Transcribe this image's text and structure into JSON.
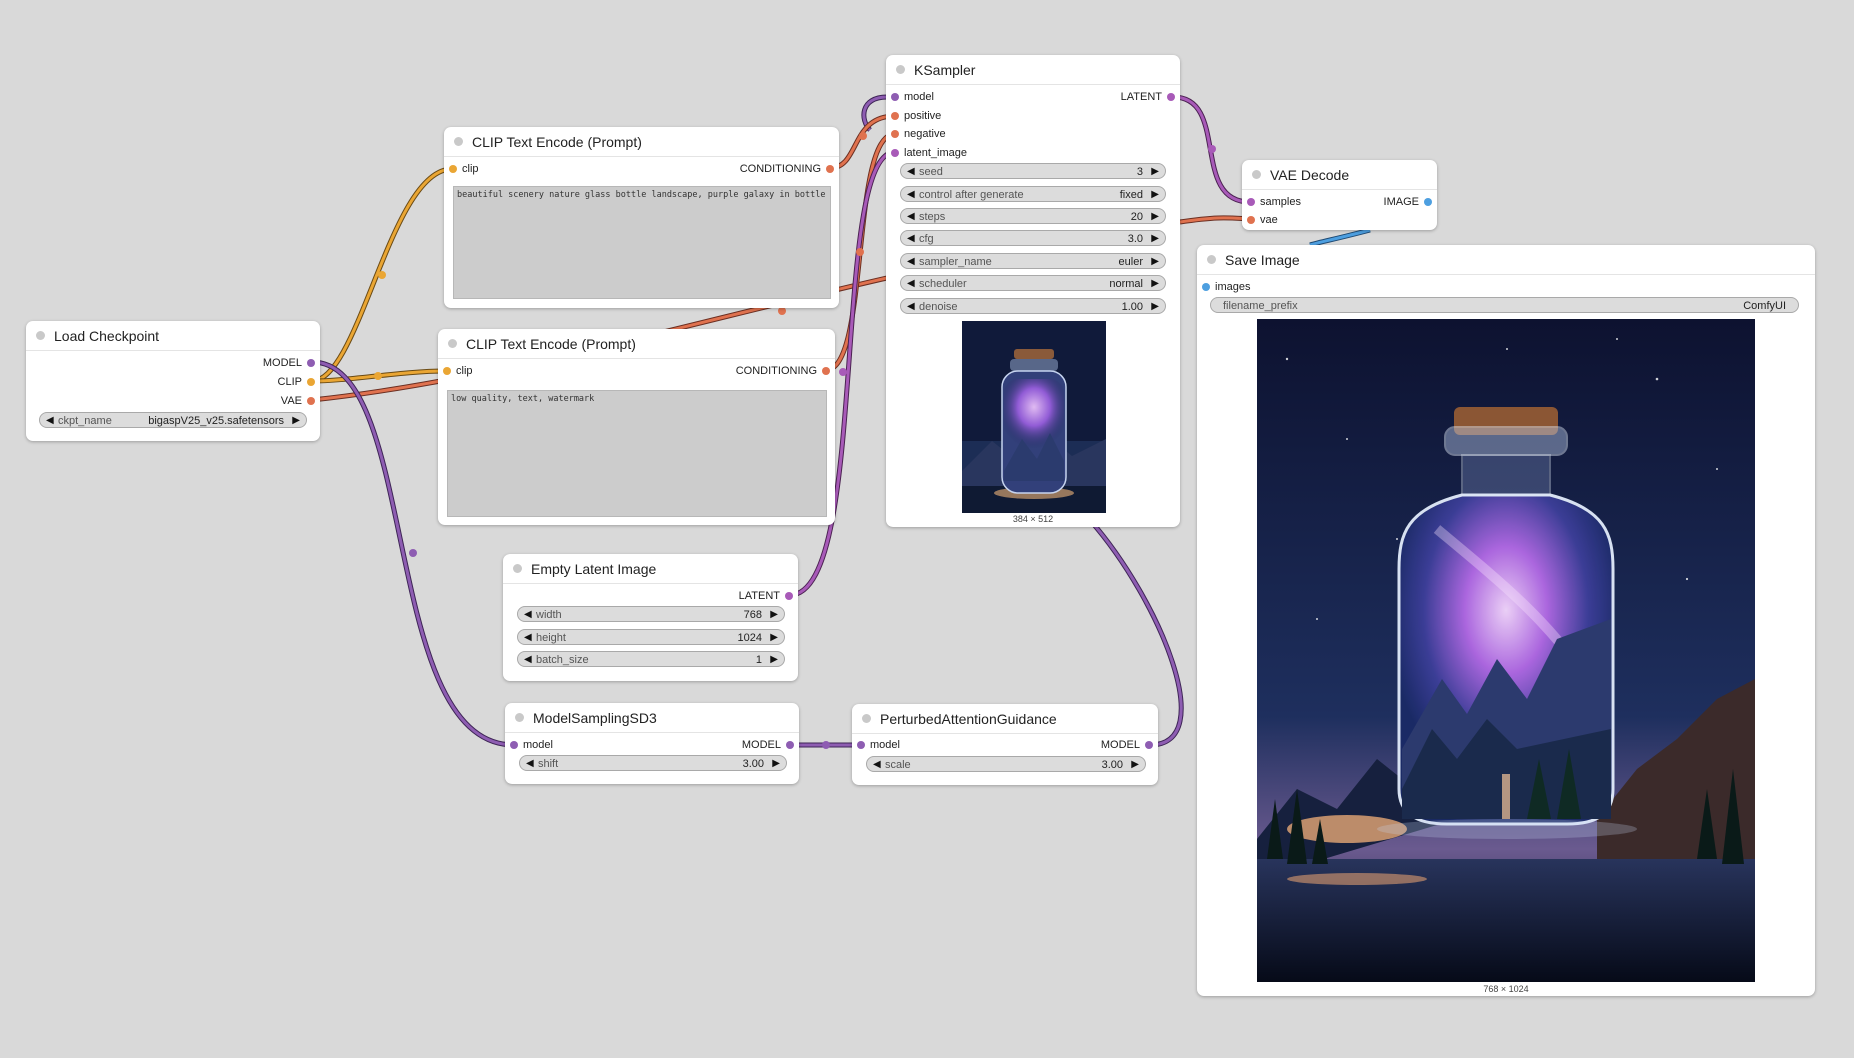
{
  "colors": {
    "canvas": "#d9d9d9",
    "model_wire": "#8e5db2",
    "clip_wire": "#eaa634",
    "vae_wire": "#e0724f",
    "conditioning_wire": "#e0724f",
    "latent_wire": "#a85ab8",
    "image_wire": "#4d9fe0"
  },
  "nodes": {
    "load_checkpoint": {
      "title": "Load Checkpoint",
      "outputs": [
        "MODEL",
        "CLIP",
        "VAE"
      ],
      "ckpt_label": "ckpt_name",
      "ckpt_value": "bigaspV25_v25.safetensors"
    },
    "clip_pos": {
      "title": "CLIP Text Encode (Prompt)",
      "input": "clip",
      "output": "CONDITIONING",
      "text": "beautiful scenery nature glass bottle landscape, purple galaxy in bottle"
    },
    "clip_neg": {
      "title": "CLIP Text Encode (Prompt)",
      "input": "clip",
      "output": "CONDITIONING",
      "text": "low quality, text, watermark"
    },
    "ksampler": {
      "title": "KSampler",
      "inputs": [
        "model",
        "positive",
        "negative",
        "latent_image"
      ],
      "output": "LATENT",
      "widgets": [
        {
          "label": "seed",
          "value": "3"
        },
        {
          "label": "control after generate",
          "value": "fixed"
        },
        {
          "label": "steps",
          "value": "20"
        },
        {
          "label": "cfg",
          "value": "3.0"
        },
        {
          "label": "sampler_name",
          "value": "euler"
        },
        {
          "label": "scheduler",
          "value": "normal"
        },
        {
          "label": "denoise",
          "value": "1.00"
        }
      ],
      "preview_size": "384 × 512"
    },
    "vae_decode": {
      "title": "VAE Decode",
      "inputs": [
        "samples",
        "vae"
      ],
      "output": "IMAGE"
    },
    "save_image": {
      "title": "Save Image",
      "input": "images",
      "prefix_label": "filename_prefix",
      "prefix_value": "ComfyUI",
      "image_size": "768 × 1024"
    },
    "empty_latent": {
      "title": "Empty Latent Image",
      "output": "LATENT",
      "widgets": [
        {
          "label": "width",
          "value": "768"
        },
        {
          "label": "height",
          "value": "1024"
        },
        {
          "label": "batch_size",
          "value": "1"
        }
      ]
    },
    "model_sampling": {
      "title": "ModelSamplingSD3",
      "input": "model",
      "output": "MODEL",
      "widget": {
        "label": "shift",
        "value": "3.00"
      }
    },
    "pag": {
      "title": "PerturbedAttentionGuidance",
      "input": "model",
      "output": "MODEL",
      "widget": {
        "label": "scale",
        "value": "3.00"
      }
    }
  }
}
